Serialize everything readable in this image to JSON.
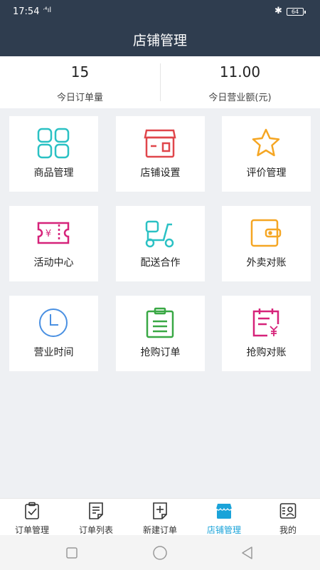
{
  "status": {
    "time": "17:54",
    "signal": "ᐧ⁴ıl",
    "battery": "64"
  },
  "header": {
    "title": "店铺管理"
  },
  "stats": [
    {
      "value": "15",
      "label": "今日订单量"
    },
    {
      "value": "11.00",
      "label": "今日营业额(元)"
    }
  ],
  "tiles": [
    {
      "label": "商品管理",
      "icon": "grid-icon",
      "color": "#2bc1c4"
    },
    {
      "label": "店铺设置",
      "icon": "storefront-icon",
      "color": "#e0464b"
    },
    {
      "label": "评价管理",
      "icon": "star-icon",
      "color": "#f5a623"
    },
    {
      "label": "活动中心",
      "icon": "coupon-icon",
      "color": "#d6237a"
    },
    {
      "label": "配送合作",
      "icon": "scooter-icon",
      "color": "#2bc1c4"
    },
    {
      "label": "外卖对账",
      "icon": "wallet-icon",
      "color": "#f5a623"
    },
    {
      "label": "营业时间",
      "icon": "clock-icon",
      "color": "#4a90e2"
    },
    {
      "label": "抢购订单",
      "icon": "clipboard-icon",
      "color": "#39a844"
    },
    {
      "label": "抢购对账",
      "icon": "calendar-yen-icon",
      "color": "#d6237a"
    }
  ],
  "coupon_glyph": "¥",
  "tabs": [
    {
      "label": "订单管理",
      "icon": "clipboard-check-icon",
      "active": false
    },
    {
      "label": "订单列表",
      "icon": "list-doc-icon",
      "active": false
    },
    {
      "label": "新建订单",
      "icon": "new-doc-icon",
      "active": false
    },
    {
      "label": "店铺管理",
      "icon": "store-icon",
      "active": true
    },
    {
      "label": "我的",
      "icon": "profile-card-icon",
      "active": false
    }
  ],
  "colors": {
    "header": "#2f3d4f",
    "accent": "#1aa3d9"
  }
}
